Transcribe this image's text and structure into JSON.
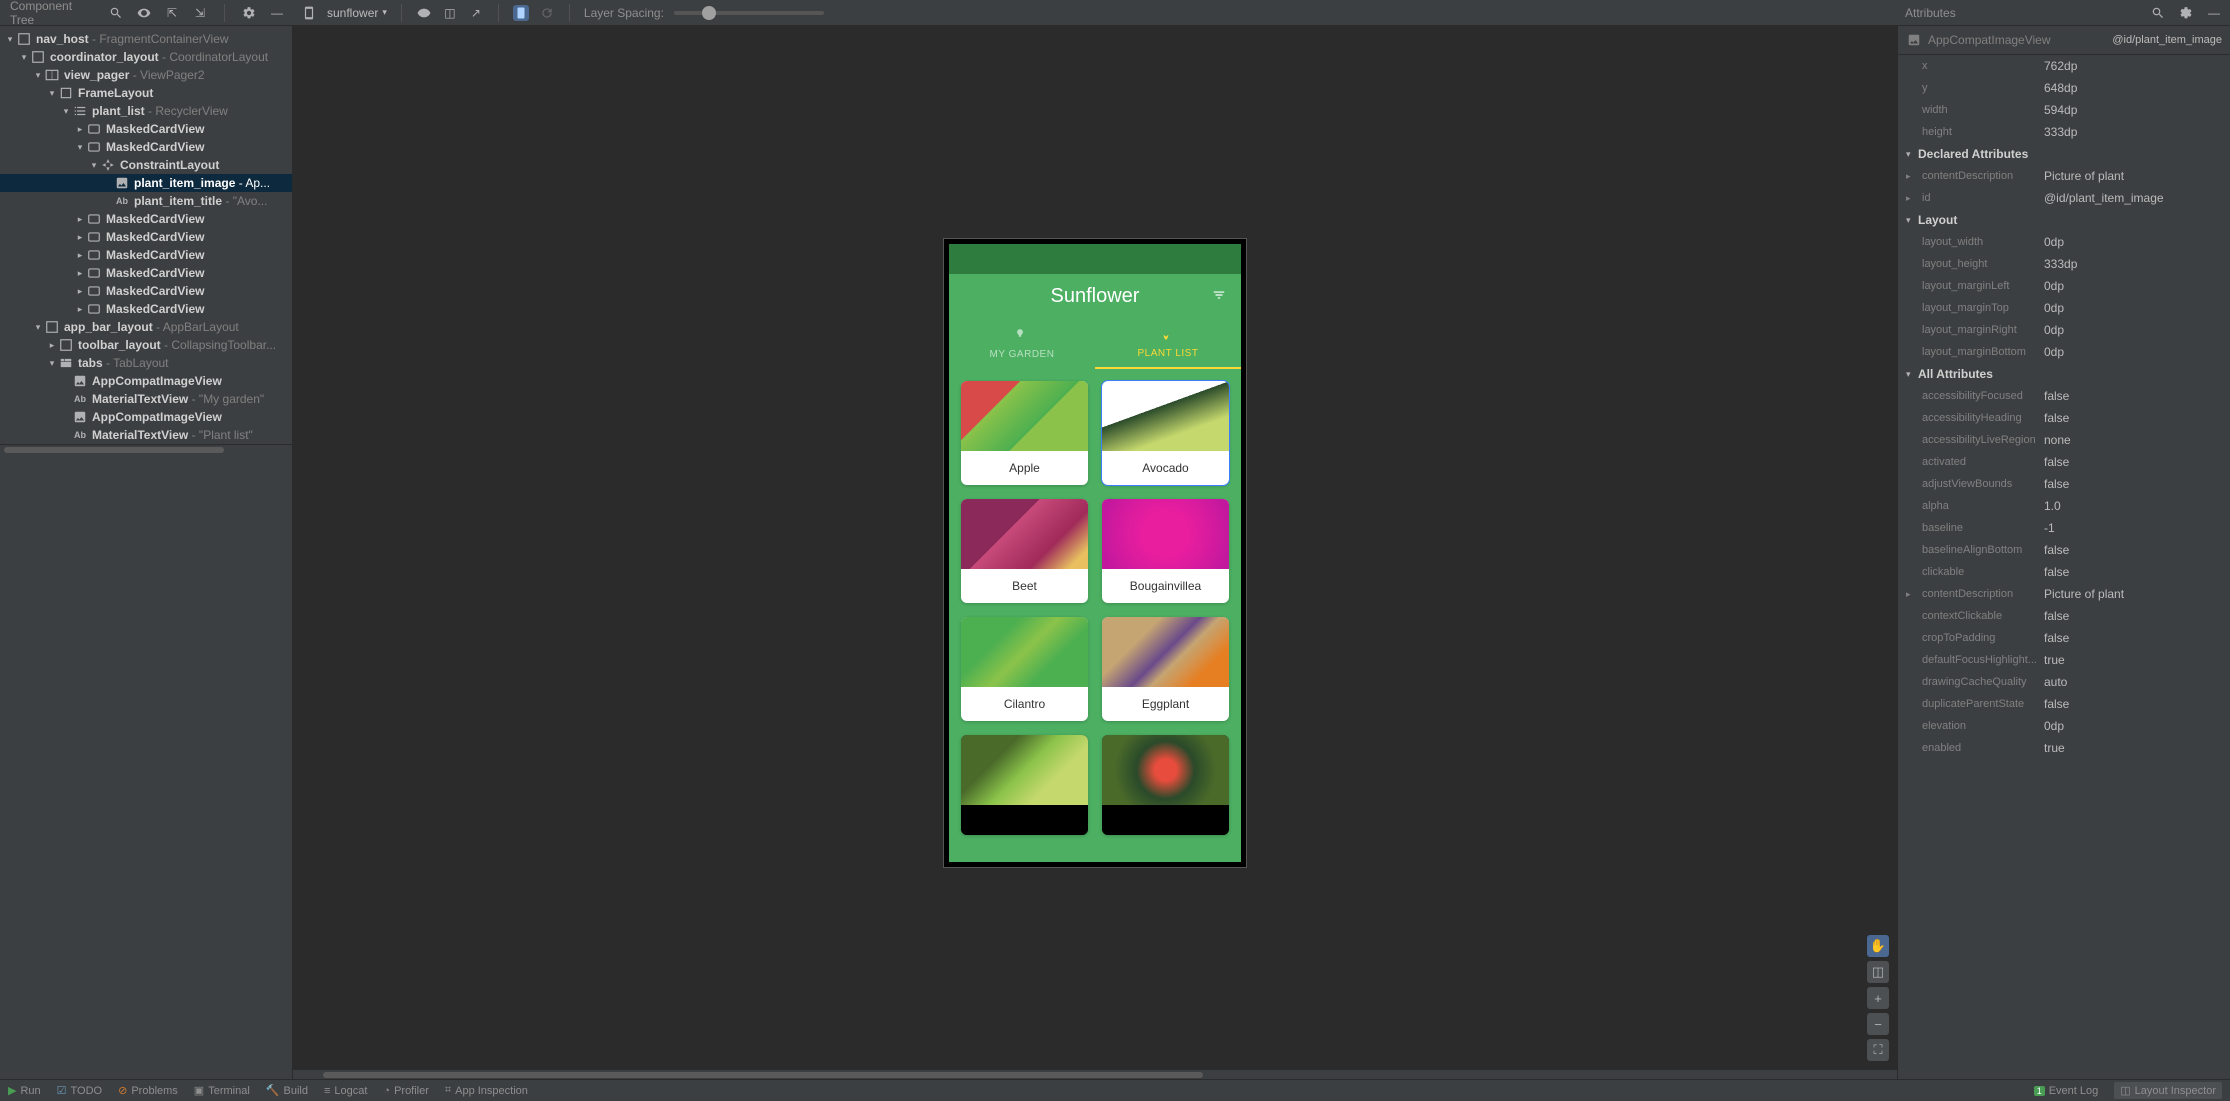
{
  "panels": {
    "tree_title": "Component Tree",
    "attributes_title": "Attributes"
  },
  "toolbar": {
    "device_name": "sunflower",
    "layer_spacing_label": "Layer Spacing:"
  },
  "tree": [
    {
      "depth": 0,
      "arrow": "▾",
      "icon": "container",
      "bold": "nav_host",
      "rest": " - FragmentContainerView"
    },
    {
      "depth": 1,
      "arrow": "▾",
      "icon": "container",
      "bold": "coordinator_layout",
      "rest": " - CoordinatorLayout"
    },
    {
      "depth": 2,
      "arrow": "▾",
      "icon": "pager",
      "bold": "view_pager",
      "rest": " - ViewPager2"
    },
    {
      "depth": 3,
      "arrow": "▾",
      "icon": "frame",
      "bold": "FrameLayout",
      "rest": ""
    },
    {
      "depth": 4,
      "arrow": "▾",
      "icon": "list",
      "bold": "plant_list",
      "rest": " - RecyclerView"
    },
    {
      "depth": 5,
      "arrow": "▸",
      "icon": "card",
      "bold": "MaskedCardView",
      "rest": ""
    },
    {
      "depth": 5,
      "arrow": "▾",
      "icon": "card",
      "bold": "MaskedCardView",
      "rest": ""
    },
    {
      "depth": 6,
      "arrow": "▾",
      "icon": "constraint",
      "bold": "ConstraintLayout",
      "rest": ""
    },
    {
      "depth": 7,
      "arrow": "",
      "icon": "image",
      "bold": "plant_item_image",
      "rest": " - Ap...",
      "selected": true
    },
    {
      "depth": 7,
      "arrow": "",
      "icon": "text",
      "bold": "plant_item_title",
      "rest": " - \"Avo..."
    },
    {
      "depth": 5,
      "arrow": "▸",
      "icon": "card",
      "bold": "MaskedCardView",
      "rest": ""
    },
    {
      "depth": 5,
      "arrow": "▸",
      "icon": "card",
      "bold": "MaskedCardView",
      "rest": ""
    },
    {
      "depth": 5,
      "arrow": "▸",
      "icon": "card",
      "bold": "MaskedCardView",
      "rest": ""
    },
    {
      "depth": 5,
      "arrow": "▸",
      "icon": "card",
      "bold": "MaskedCardView",
      "rest": ""
    },
    {
      "depth": 5,
      "arrow": "▸",
      "icon": "card",
      "bold": "MaskedCardView",
      "rest": ""
    },
    {
      "depth": 5,
      "arrow": "▸",
      "icon": "card",
      "bold": "MaskedCardView",
      "rest": ""
    },
    {
      "depth": 2,
      "arrow": "▾",
      "icon": "container",
      "bold": "app_bar_layout",
      "rest": " - AppBarLayout"
    },
    {
      "depth": 3,
      "arrow": "▸",
      "icon": "container",
      "bold": "toolbar_layout",
      "rest": " - CollapsingToolbar..."
    },
    {
      "depth": 3,
      "arrow": "▾",
      "icon": "tabs",
      "bold": "tabs",
      "rest": " - TabLayout"
    },
    {
      "depth": 4,
      "arrow": "",
      "icon": "image",
      "bold": "AppCompatImageView",
      "rest": ""
    },
    {
      "depth": 4,
      "arrow": "",
      "icon": "text",
      "bold": "MaterialTextView",
      "rest": " - \"My garden\""
    },
    {
      "depth": 4,
      "arrow": "",
      "icon": "image",
      "bold": "AppCompatImageView",
      "rest": ""
    },
    {
      "depth": 4,
      "arrow": "",
      "icon": "text",
      "bold": "MaterialTextView",
      "rest": " - \"Plant list\""
    }
  ],
  "preview": {
    "app_title": "Sunflower",
    "tabs": [
      "MY GARDEN",
      "PLANT LIST"
    ],
    "selection_label": "AppCompatImageView",
    "cards": [
      {
        "title": "Apple",
        "img": "apple"
      },
      {
        "title": "Avocado",
        "img": "avocado",
        "highlighted": true
      },
      {
        "title": "Beet",
        "img": "beet"
      },
      {
        "title": "Bougainvillea",
        "img": "bougainvillea"
      },
      {
        "title": "Cilantro",
        "img": "cilantro"
      },
      {
        "title": "Eggplant",
        "img": "eggplant"
      },
      {
        "title": "",
        "img": "grape"
      },
      {
        "title": "",
        "img": "hibiscus"
      }
    ]
  },
  "attributes": {
    "type": "AppCompatImageView",
    "id_full": "@id/plant_item_image",
    "basic": [
      {
        "k": "x",
        "v": "762dp"
      },
      {
        "k": "y",
        "v": "648dp"
      },
      {
        "k": "width",
        "v": "594dp"
      },
      {
        "k": "height",
        "v": "333dp"
      }
    ],
    "sections": [
      {
        "title": "Declared Attributes",
        "rows": [
          {
            "k": "contentDescription",
            "v": "Picture of plant",
            "arrow": true
          },
          {
            "k": "id",
            "v": "@id/plant_item_image",
            "arrow": true
          }
        ]
      },
      {
        "title": "Layout",
        "rows": [
          {
            "k": "layout_width",
            "v": "0dp"
          },
          {
            "k": "layout_height",
            "v": "333dp"
          },
          {
            "k": "layout_marginLeft",
            "v": "0dp"
          },
          {
            "k": "layout_marginTop",
            "v": "0dp"
          },
          {
            "k": "layout_marginRight",
            "v": "0dp"
          },
          {
            "k": "layout_marginBottom",
            "v": "0dp"
          }
        ]
      },
      {
        "title": "All Attributes",
        "rows": [
          {
            "k": "accessibilityFocused",
            "v": "false"
          },
          {
            "k": "accessibilityHeading",
            "v": "false"
          },
          {
            "k": "accessibilityLiveRegion",
            "v": "none"
          },
          {
            "k": "activated",
            "v": "false"
          },
          {
            "k": "adjustViewBounds",
            "v": "false"
          },
          {
            "k": "alpha",
            "v": "1.0"
          },
          {
            "k": "baseline",
            "v": "-1"
          },
          {
            "k": "baselineAlignBottom",
            "v": "false"
          },
          {
            "k": "clickable",
            "v": "false"
          },
          {
            "k": "contentDescription",
            "v": "Picture of plant",
            "arrow": true
          },
          {
            "k": "contextClickable",
            "v": "false"
          },
          {
            "k": "cropToPadding",
            "v": "false"
          },
          {
            "k": "defaultFocusHighlight...",
            "v": "true"
          },
          {
            "k": "drawingCacheQuality",
            "v": "auto"
          },
          {
            "k": "duplicateParentState",
            "v": "false"
          },
          {
            "k": "elevation",
            "v": "0dp"
          },
          {
            "k": "enabled",
            "v": "true"
          }
        ]
      }
    ]
  },
  "bottom": {
    "run": "Run",
    "todo": "TODO",
    "problems": "Problems",
    "terminal": "Terminal",
    "build": "Build",
    "logcat": "Logcat",
    "profiler": "Profiler",
    "app_inspection": "App Inspection",
    "event_log": "Event Log",
    "event_count": "1",
    "layout_inspector": "Layout Inspector"
  }
}
